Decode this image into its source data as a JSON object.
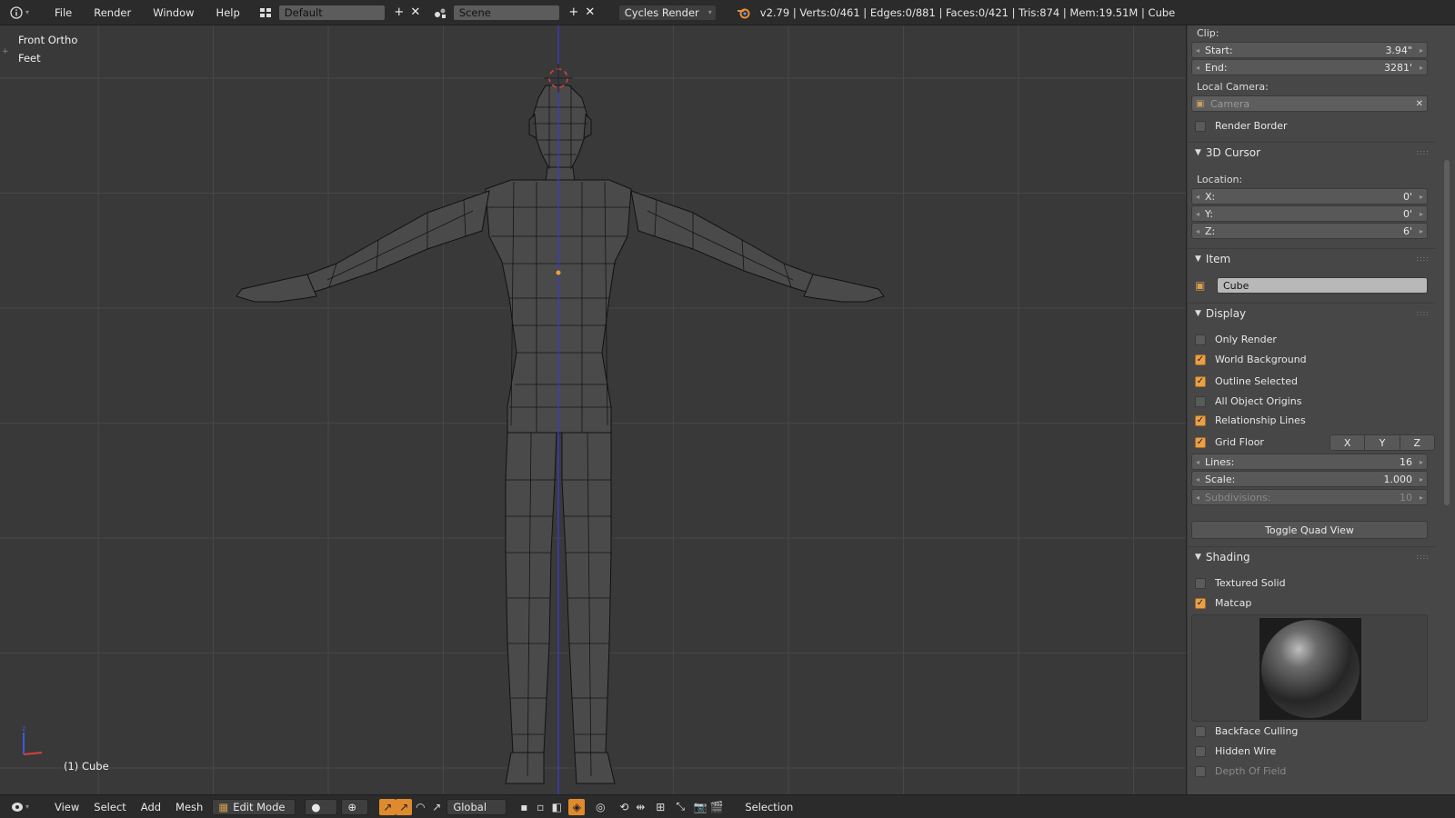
{
  "topbar": {
    "info_icon": "info-icon",
    "menus": [
      "File",
      "Render",
      "Window",
      "Help"
    ],
    "screen_layout": "Default",
    "scene": "Scene",
    "render_engine": "Cycles Render",
    "stats": "v2.79 | Verts:0/461 | Edges:0/881 | Faces:0/421 | Tris:874 | Mem:19.51M | Cube"
  },
  "viewport": {
    "view_name": "Front Ortho",
    "units": "Feet",
    "active_object": "(1) Cube"
  },
  "props": {
    "clip_label": "Clip:",
    "clip_start_label": "Start:",
    "clip_start_value": "3.94\"",
    "clip_end_label": "End:",
    "clip_end_value": "3281'",
    "local_camera_label": "Local Camera:",
    "local_camera_placeholder": "Camera",
    "render_border": "Render Border",
    "cursor_header": "3D Cursor",
    "location_label": "Location:",
    "cursor_x_label": "X:",
    "cursor_x_value": "0'",
    "cursor_y_label": "Y:",
    "cursor_y_value": "0'",
    "cursor_z_label": "Z:",
    "cursor_z_value": "6'",
    "item_header": "Item",
    "item_name": "Cube",
    "display_header": "Display",
    "only_render": "Only Render",
    "world_background": "World Background",
    "outline_selected": "Outline Selected",
    "all_object_origins": "All Object Origins",
    "relationship_lines": "Relationship Lines",
    "grid_floor": "Grid Floor",
    "axis_x": "X",
    "axis_y": "Y",
    "axis_z": "Z",
    "lines_label": "Lines:",
    "lines_value": "16",
    "scale_label": "Scale:",
    "scale_value": "1.000",
    "subdivisions_label": "Subdivisions:",
    "subdivisions_value": "10",
    "toggle_quad_view": "Toggle Quad View",
    "shading_header": "Shading",
    "textured_solid": "Textured Solid",
    "matcap": "Matcap",
    "backface_culling": "Backface Culling",
    "hidden_wire": "Hidden Wire",
    "depth_of_field": "Depth Of Field"
  },
  "checks": {
    "render_border": false,
    "only_render": false,
    "world_background": true,
    "outline_selected": true,
    "all_object_origins": false,
    "relationship_lines": true,
    "grid_floor": true,
    "textured_solid": false,
    "matcap": true,
    "backface_culling": false,
    "hidden_wire": false,
    "depth_of_field": false
  },
  "bottombar": {
    "menus": [
      "View",
      "Select",
      "Add",
      "Mesh"
    ],
    "mode": "Edit Mode",
    "orientation": "Global",
    "selection_label": "Selection"
  },
  "colors": {
    "viewport_bg": "#393939",
    "panel_bg": "#474747",
    "checkbox_on": "#e8a04a",
    "mesh_fill": "#4a4a4a",
    "mesh_edge": "#111111"
  }
}
